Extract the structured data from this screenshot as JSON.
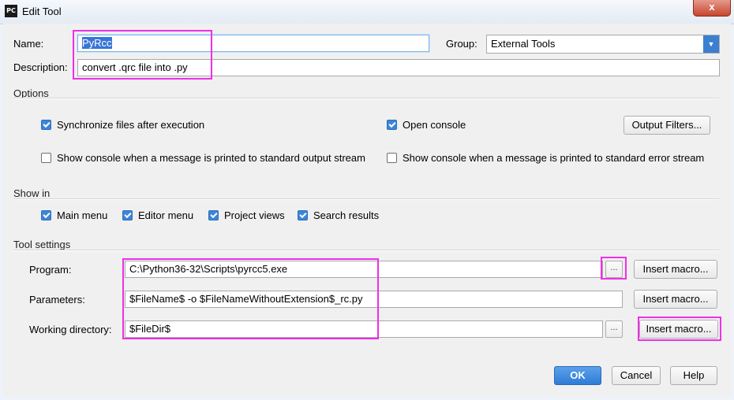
{
  "window": {
    "app_icon_text": "PC",
    "title": "Edit Tool",
    "close_glyph": "x"
  },
  "form": {
    "name_label": "Name:",
    "name_value": "PyRcc",
    "group_label": "Group:",
    "group_value": "External Tools",
    "description_label": "Description:",
    "description_value": "convert .qrc file into .py"
  },
  "options": {
    "title": "Options",
    "sync_files": {
      "label": "Synchronize files after execution",
      "checked": true
    },
    "open_console": {
      "label": "Open console",
      "checked": true
    },
    "output_filters_label": "Output Filters...",
    "show_console_stdout": {
      "label": "Show console when a message is printed to standard output stream",
      "checked": false
    },
    "show_console_stderr": {
      "label": "Show console when a message is printed to standard error stream",
      "checked": false
    }
  },
  "show_in": {
    "title": "Show in",
    "main_menu": {
      "label": "Main menu",
      "checked": true
    },
    "editor_menu": {
      "label": "Editor menu",
      "checked": true
    },
    "project_views": {
      "label": "Project views",
      "checked": true
    },
    "search_results": {
      "label": "Search results",
      "checked": true
    }
  },
  "tool_settings": {
    "title": "Tool settings",
    "program_label": "Program:",
    "program_value": "C:\\Python36-32\\Scripts\\pyrcc5.exe",
    "parameters_label": "Parameters:",
    "parameters_value": "$FileName$ -o $FileNameWithoutExtension$_rc.py",
    "working_dir_label": "Working directory:",
    "working_dir_value": "$FileDir$",
    "browse_label": "...",
    "insert_macro_label": "Insert macro..."
  },
  "footer": {
    "ok_label": "OK",
    "cancel_label": "Cancel",
    "help_label": "Help"
  },
  "colors": {
    "accent": "#3d86d6",
    "highlight": "#ef2fe8",
    "primary_button": "#2e7cd6"
  }
}
